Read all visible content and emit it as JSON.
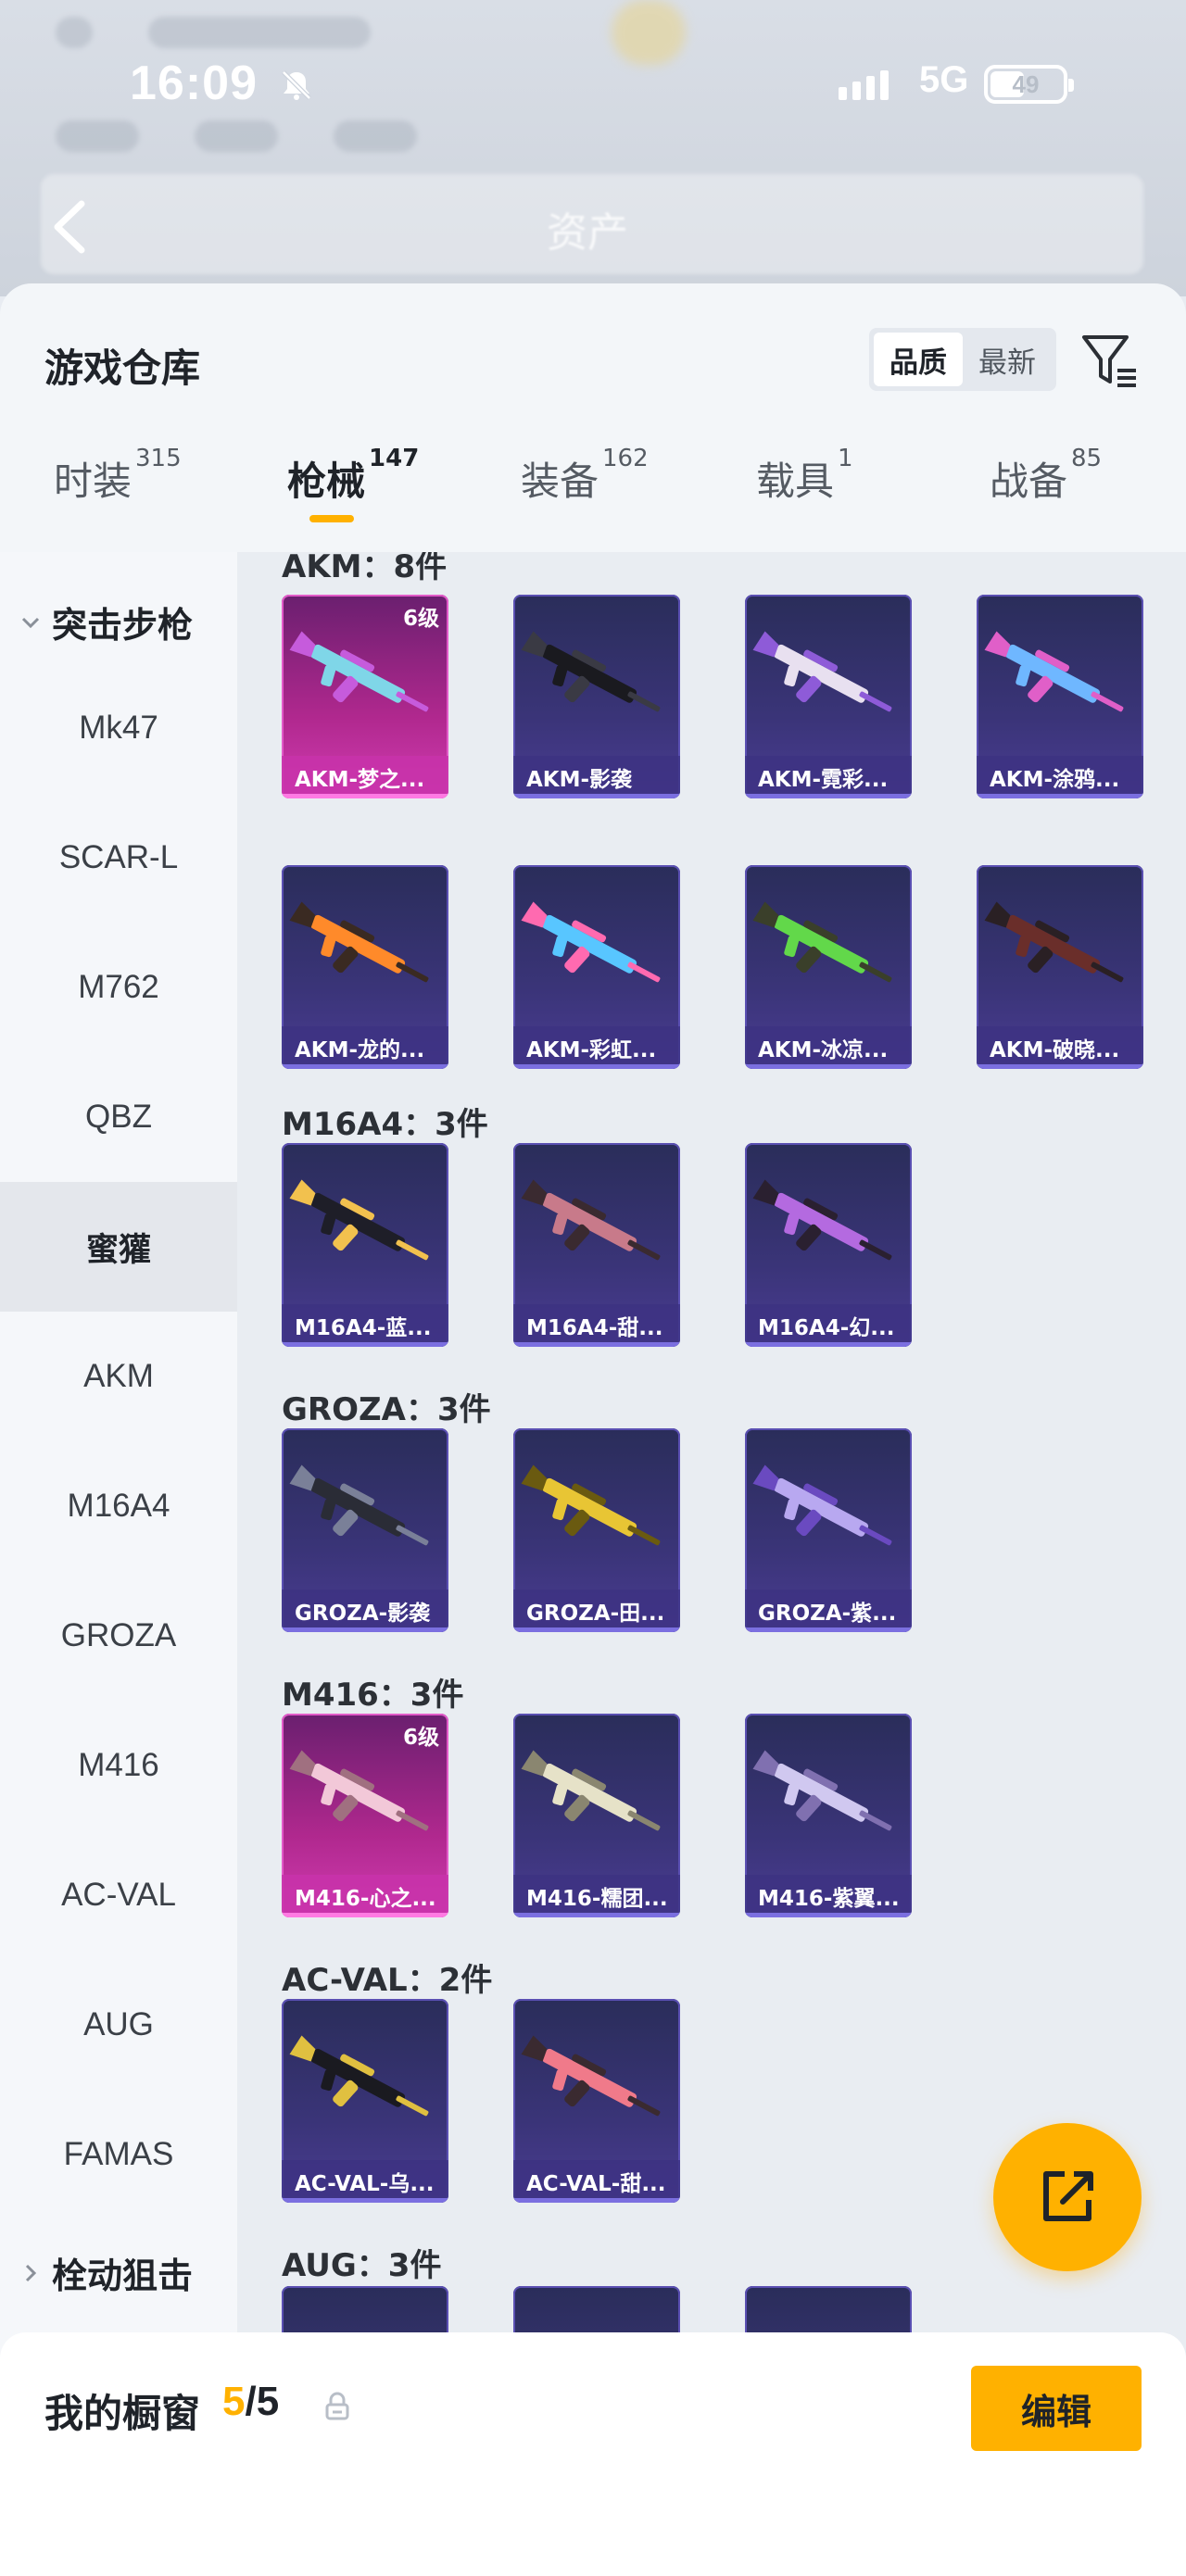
{
  "status_bar": {
    "time": "16:09",
    "network": "5G",
    "battery": "49"
  },
  "header": {
    "title": "资产"
  },
  "sheet": {
    "title": "游戏仓库",
    "sort_options": [
      "品质",
      "最新"
    ],
    "active_sort": "品质"
  },
  "tabs": [
    {
      "label": "时装",
      "count": "315"
    },
    {
      "label": "枪械",
      "count": "147"
    },
    {
      "label": "装备",
      "count": "162"
    },
    {
      "label": "载具",
      "count": "1"
    },
    {
      "label": "战备",
      "count": "85"
    }
  ],
  "sidebar": {
    "category_open": "突击步枪",
    "items": [
      "Mk47",
      "SCAR-L",
      "M762",
      "QBZ",
      "蜜獾",
      "AKM",
      "M16A4",
      "GROZA",
      "M416",
      "AC-VAL",
      "AUG",
      "FAMAS"
    ],
    "active_item": "蜜獾",
    "category_closed": "栓动狙击"
  },
  "sections": [
    {
      "title": "AKM：8件",
      "cards": [
        {
          "name": "AKM-梦之...",
          "level": "6级",
          "rarity": "pink"
        },
        {
          "name": "AKM-影袭",
          "rarity": "purple"
        },
        {
          "name": "AKM-霓彩...",
          "rarity": "purple"
        },
        {
          "name": "AKM-涂鸦...",
          "rarity": "purple"
        },
        {
          "name": "AKM-龙的...",
          "rarity": "purple"
        },
        {
          "name": "AKM-彩虹...",
          "rarity": "purple"
        },
        {
          "name": "AKM-冰凉...",
          "rarity": "purple"
        },
        {
          "name": "AKM-破晓...",
          "rarity": "purple"
        }
      ]
    },
    {
      "title": "M16A4：3件",
      "cards": [
        {
          "name": "M16A4-蓝...",
          "rarity": "purple"
        },
        {
          "name": "M16A4-甜...",
          "rarity": "purple"
        },
        {
          "name": "M16A4-幻...",
          "rarity": "purple"
        }
      ]
    },
    {
      "title": "GROZA：3件",
      "cards": [
        {
          "name": "GROZA-影袭",
          "rarity": "purple"
        },
        {
          "name": "GROZA-田...",
          "rarity": "purple"
        },
        {
          "name": "GROZA-紫...",
          "rarity": "purple"
        }
      ]
    },
    {
      "title": "M416：3件",
      "cards": [
        {
          "name": "M416-心之...",
          "level": "6级",
          "rarity": "pink"
        },
        {
          "name": "M416-糯团...",
          "rarity": "purple"
        },
        {
          "name": "M416-紫翼...",
          "rarity": "purple"
        }
      ]
    },
    {
      "title": "AC-VAL：2件",
      "cards": [
        {
          "name": "AC-VAL-乌...",
          "rarity": "purple"
        },
        {
          "name": "AC-VAL-甜...",
          "rarity": "purple"
        }
      ]
    },
    {
      "title": "AUG：3件",
      "cards": []
    }
  ],
  "showcase": {
    "label": "我的橱窗",
    "current": "5",
    "total": "5",
    "edit_label": "编辑"
  },
  "colors": {
    "accent": "#ffb100",
    "rare_purple": "#3a3478",
    "rare_pink": "#b0288e"
  }
}
